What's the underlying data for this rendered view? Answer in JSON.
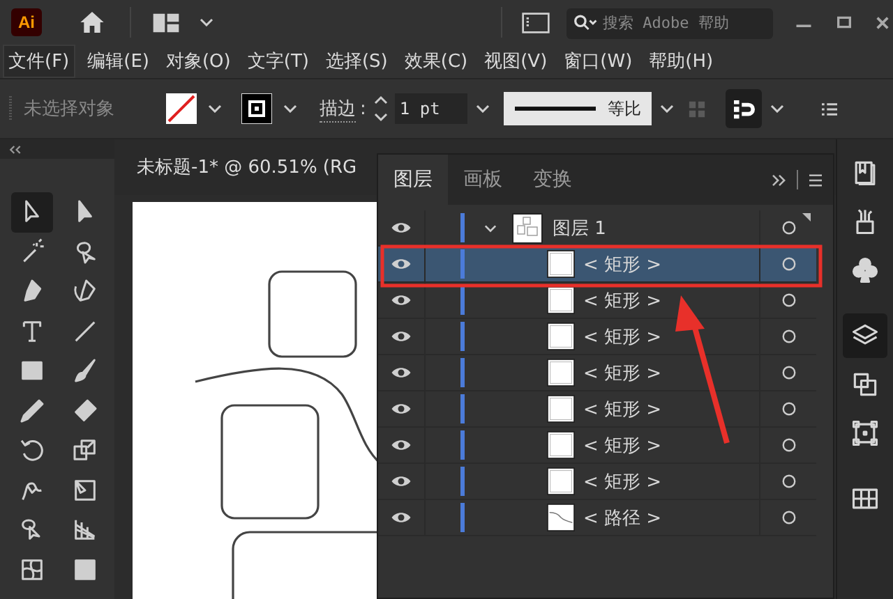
{
  "app": {
    "logo": "Ai",
    "search": {
      "placeholder": "搜索 Adobe 帮助"
    }
  },
  "menu": [
    {
      "label": "文件(F)",
      "selected": true
    },
    {
      "label": "编辑(E)",
      "selected": false
    },
    {
      "label": "对象(O)",
      "selected": false
    },
    {
      "label": "文字(T)",
      "selected": false
    },
    {
      "label": "选择(S)",
      "selected": false
    },
    {
      "label": "效果(C)",
      "selected": false
    },
    {
      "label": "视图(V)",
      "selected": false
    },
    {
      "label": "窗口(W)",
      "selected": false
    },
    {
      "label": "帮助(H)",
      "selected": false
    }
  ],
  "control_bar": {
    "selection": "未选择对象",
    "stroke_label": "描边",
    "stroke_colon": ":",
    "stroke_weight": "1 pt",
    "stroke_profile": "等比"
  },
  "document_tab": "未标题-1* @ 60.51% (RG",
  "toolbar": {
    "tools": [
      {
        "selected": true
      },
      {
        "selected": false
      },
      {
        "selected": false
      },
      {
        "selected": false
      },
      {
        "selected": false
      },
      {
        "selected": false
      },
      {
        "selected": false
      },
      {
        "selected": false
      },
      {
        "selected": false
      },
      {
        "selected": false
      },
      {
        "selected": false
      },
      {
        "selected": false
      },
      {
        "selected": false
      },
      {
        "selected": false
      },
      {
        "selected": false
      },
      {
        "selected": false
      },
      {
        "selected": false
      },
      {
        "selected": false
      },
      {
        "selected": false
      },
      {
        "selected": false
      }
    ]
  },
  "dock": {
    "items": [
      {
        "selected": false
      },
      {
        "selected": false
      },
      {
        "selected": false
      },
      {
        "selected": true
      },
      {
        "selected": false
      },
      {
        "selected": false
      },
      {
        "selected": false
      }
    ]
  },
  "layers_panel": {
    "tabs": [
      {
        "label": "图层",
        "selected": true
      },
      {
        "label": "画板",
        "selected": false
      },
      {
        "label": "变换",
        "selected": false
      }
    ],
    "layers": [
      {
        "name": "图层 1",
        "visible": true,
        "expanded": true,
        "children": [
          {
            "name": "< 矩形 >",
            "kind": "rect",
            "visible": true,
            "selected": true
          },
          {
            "name": "< 矩形 >",
            "kind": "rect",
            "visible": true,
            "selected": false
          },
          {
            "name": "< 矩形 >",
            "kind": "rect",
            "visible": true,
            "selected": false
          },
          {
            "name": "< 矩形 >",
            "kind": "rect",
            "visible": true,
            "selected": false
          },
          {
            "name": "< 矩形 >",
            "kind": "rect",
            "visible": true,
            "selected": false
          },
          {
            "name": "< 矩形 >",
            "kind": "rect",
            "visible": true,
            "selected": false
          },
          {
            "name": "< 矩形 >",
            "kind": "rect",
            "visible": true,
            "selected": false
          },
          {
            "name": "< 路径 >",
            "kind": "path",
            "visible": true,
            "selected": false
          }
        ]
      }
    ]
  }
}
